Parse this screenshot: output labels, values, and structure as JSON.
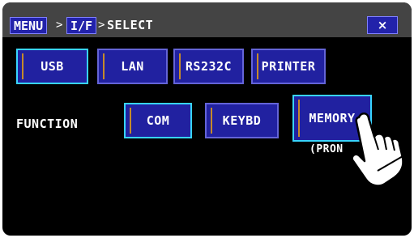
{
  "breadcrumb": {
    "menu_label": "MENU",
    "if_label": "I/F",
    "sep1": ">",
    "sep2": ">",
    "current": "SELECT"
  },
  "close_label": "×",
  "interfaces": [
    {
      "label": "USB",
      "selected": true
    },
    {
      "label": "LAN",
      "selected": false
    },
    {
      "label": "RS232C",
      "selected": false
    },
    {
      "label": "PRINTER",
      "selected": false
    }
  ],
  "function": {
    "label": "FUNCTION",
    "options": [
      {
        "label": "COM",
        "selected": true
      },
      {
        "label": "KEYBD",
        "selected": false
      },
      {
        "label": "MEMORY",
        "selected": false,
        "pressed": true
      }
    ],
    "partial_text": "(PRON"
  },
  "colors": {
    "button_bg": "#2121a0",
    "button_border": "#6464d8",
    "selected_border": "#38d4ff",
    "indicator": "#c58a2a",
    "header_bg": "#444444"
  },
  "icons": {
    "pointer": "hand-pointer-icon",
    "close": "close-icon"
  }
}
